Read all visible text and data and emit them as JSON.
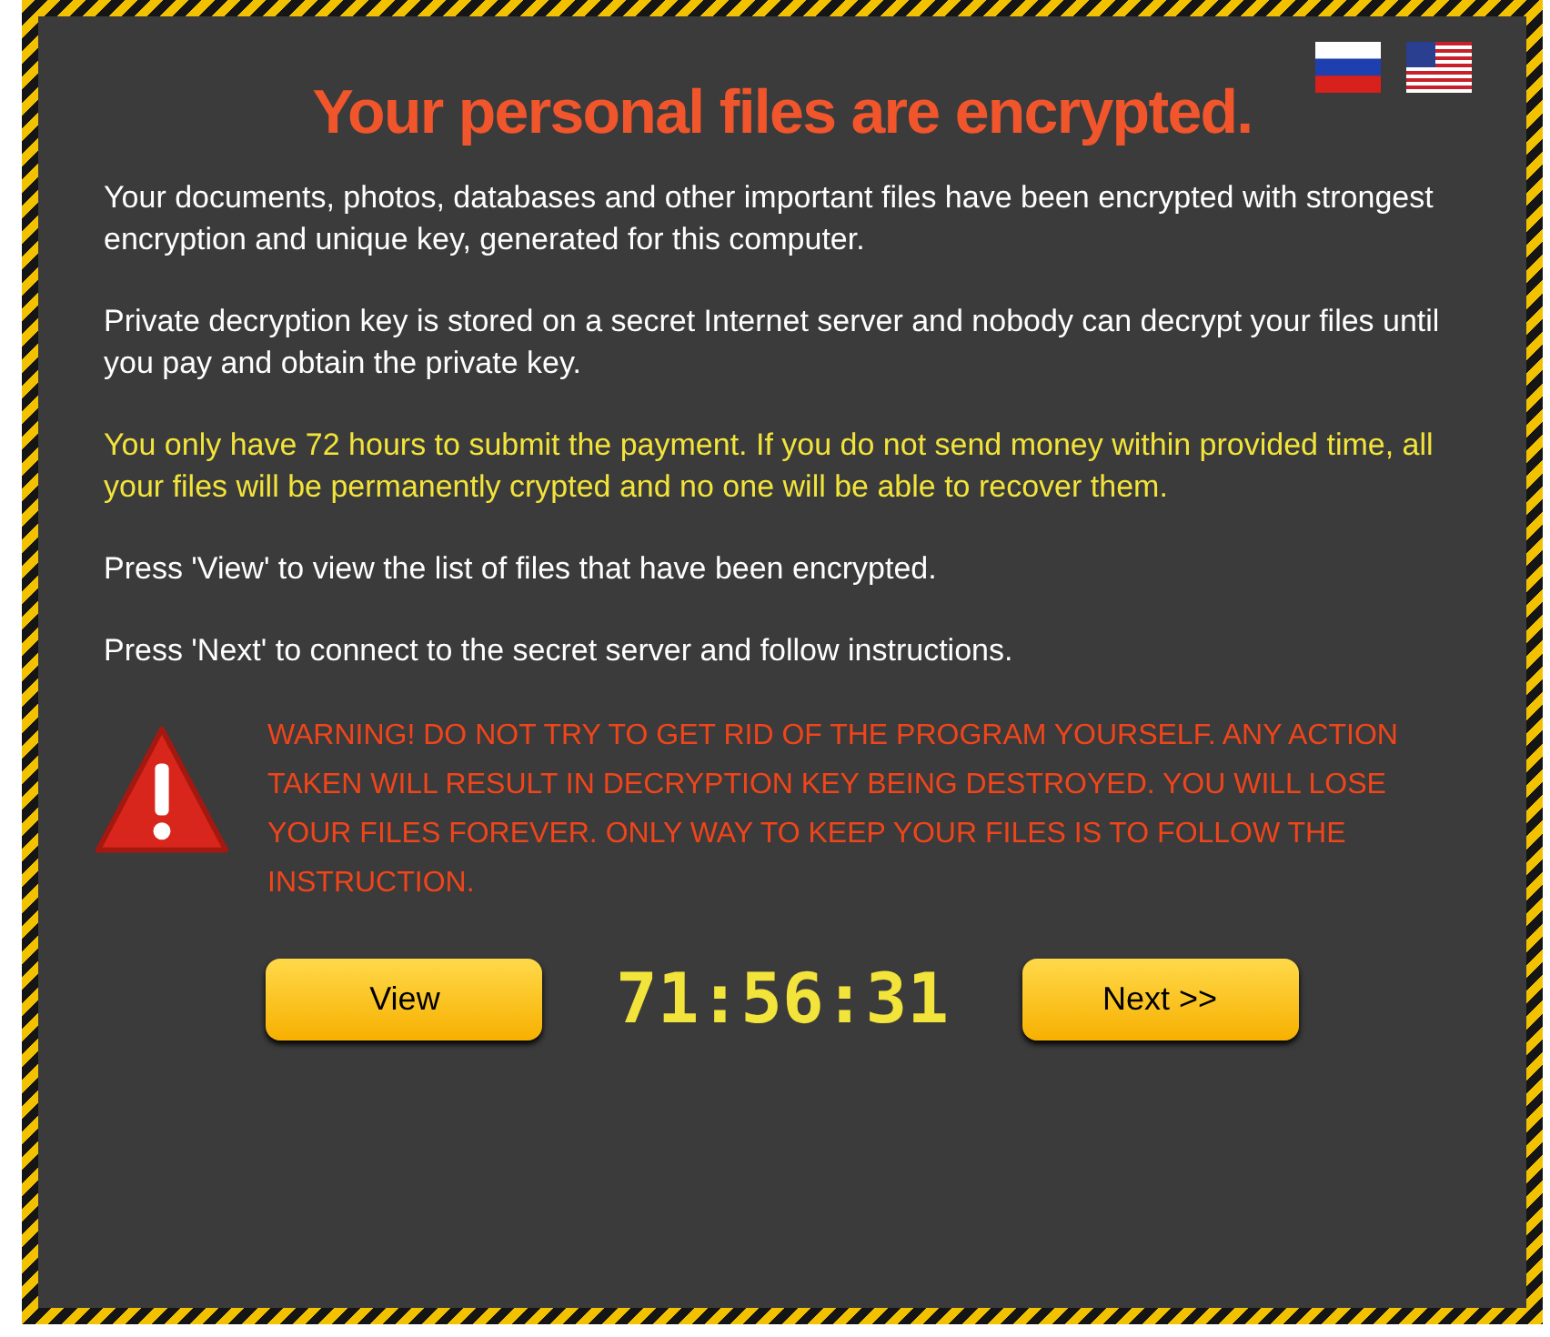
{
  "languages": [
    {
      "kind": "ru"
    },
    {
      "kind": "us"
    }
  ],
  "title": "Your personal files are encrypted.",
  "paragraphs": [
    {
      "kind": "normal",
      "text": "Your documents, photos, databases and other important files have been encrypted with strongest encryption and unique key, generated for this computer."
    },
    {
      "kind": "normal",
      "text": "Private decryption key is stored on a secret Internet server and nobody can decrypt your files until you pay and obtain the private key."
    },
    {
      "kind": "highlight",
      "text": "You only have 72 hours to submit the payment. If you do not send money within provided time, all your files will be permanently crypted and no one will be able to recover them."
    },
    {
      "kind": "normal",
      "text": "Press 'View' to view the list of files that have been encrypted."
    },
    {
      "kind": "normal",
      "text": "Press 'Next' to connect to the secret server and follow instructions."
    }
  ],
  "warning": "WARNING! DO NOT TRY TO GET RID OF THE PROGRAM YOURSELF. ANY ACTION TAKEN WILL RESULT IN DECRYPTION KEY BEING DESTROYED. YOU WILL LOSE YOUR FILES FOREVER. ONLY WAY TO KEEP YOUR FILES IS TO FOLLOW THE INSTRUCTION.",
  "view_button": "View",
  "timer": "71:56:31",
  "next_button": "Next >>"
}
